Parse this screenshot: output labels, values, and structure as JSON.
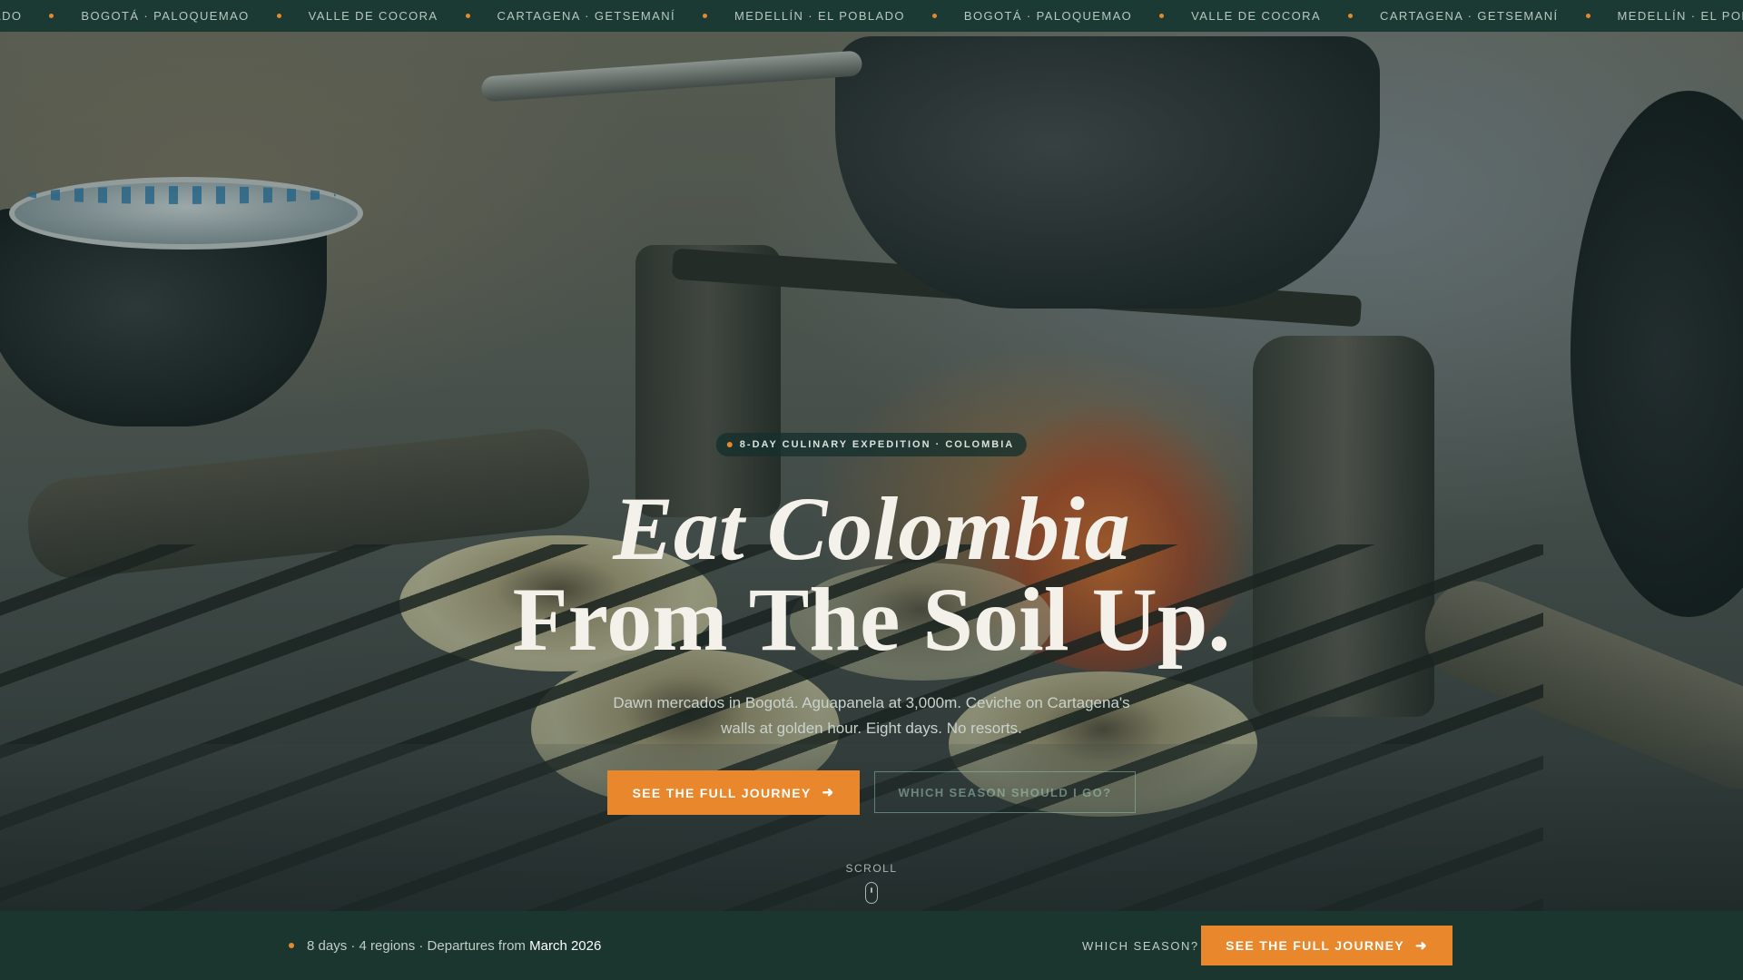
{
  "ticker": {
    "leading_fragment": "ADO",
    "items": [
      "BOGOTÁ · PALOQUEMAO",
      "VALLE DE COCORA",
      "CARTAGENA · GETSEMANÍ",
      "MEDELLÍN · EL POBLADO",
      "BOGOTÁ · PALOQUEMAO",
      "VALLE DE COCORA",
      "CARTAGENA · GETSEMANÍ",
      "MEDELLÍN · EL POBLADO"
    ]
  },
  "hero": {
    "eyebrow": "8-DAY CULINARY EXPEDITION · COLOMBIA",
    "title_line1": "Eat Colombia",
    "title_line2": "From The Soil Up.",
    "subtitle": "Dawn mercados in Bogotá. Aguapanela at 3,000m. Ceviche on Cartagena's walls at golden hour. Eight days. No resorts.",
    "primary_cta": "SEE THE FULL JOURNEY",
    "secondary_cta": "WHICH SEASON SHOULD I GO?",
    "scroll_label": "SCROLL"
  },
  "bottom_bar": {
    "meta_text": "8 days · 4 regions · Departures from",
    "meta_date": "March 2026",
    "season_link": "WHICH SEASON?",
    "cta": "SEE THE FULL JOURNEY"
  },
  "icons": {
    "arrow": "arrow-right-icon",
    "scroll": "mouse-icon",
    "dot": "dot-icon"
  },
  "colors": {
    "accent": "#e8872c",
    "dark_green": "#1b352f",
    "ticker_bg": "#1c3a34",
    "title_text": "#f3f1ea"
  }
}
